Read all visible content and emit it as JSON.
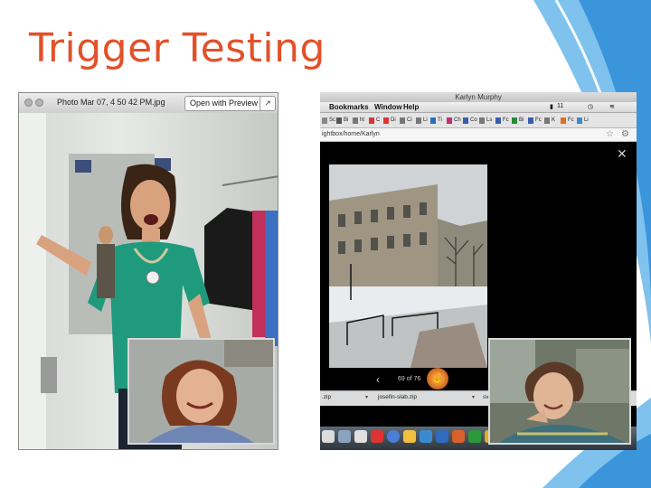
{
  "slide": {
    "title": "Trigger Testing"
  },
  "left_window": {
    "filename": "Photo Mar 07, 4 50 42 PM.jpg",
    "open_button": "Open with Preview",
    "share_icon": "share-icon"
  },
  "right_window": {
    "title": "Karlyn Murphy",
    "menus": [
      "Bookmarks",
      "Window",
      "Help"
    ],
    "status": {
      "battery": "11"
    },
    "bookmarks": [
      "Sc",
      "Bi",
      "ht",
      "C",
      "Di",
      "Ci",
      "Li",
      "Ti",
      "Ch",
      "Co",
      "Ls",
      "Fc",
      "Bi",
      "Fc",
      "K",
      "Fc",
      "Li"
    ],
    "url": "ightbox/home/Karlyn",
    "counter": "69 of 76",
    "downloads": [
      ".zip",
      "josefin-slab.zip",
      "svj"
    ]
  },
  "colors": {
    "title": "#e2512a",
    "accent_blue": "#2f8fd8"
  }
}
